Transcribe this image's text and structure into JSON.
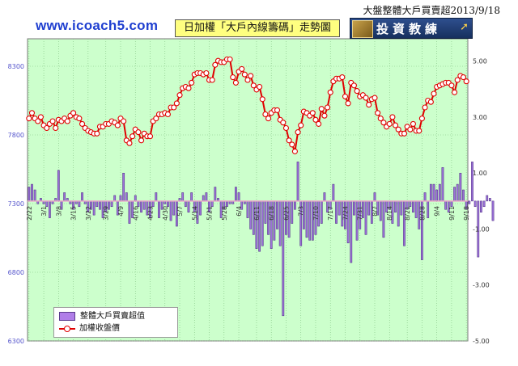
{
  "header": {
    "date_label": "大盤整體大戶買賣超2013/9/18",
    "site_url": "www.icoach5.com",
    "chart_title": "日加權「大戶內線籌碼」走勢圖",
    "logo_text": "投資教練"
  },
  "colors": {
    "plot_background": "#ccffcc",
    "grid": "#7fbf7f",
    "index_line": "#e00000",
    "index_marker_fill": "#ffffff",
    "bar_fill": "#9c72d8",
    "bar_stroke": "#4b2c80",
    "zero_line": "#e8a8c8",
    "left_axis_text": "#5555cc",
    "right_axis_text": "#333333"
  },
  "chart_data": {
    "type": "bar+line",
    "legend": {
      "position": "bottom-left",
      "entries": [
        "整體大戶買賣超值",
        "加權收盤價"
      ]
    },
    "left_axis": {
      "ticks": [
        "6300",
        "6800",
        "7300",
        "7800",
        "8300"
      ],
      "ylim": [
        6300,
        8500
      ]
    },
    "right_axis": {
      "ticks": [
        "-5.00",
        "-3.00",
        "-1.00",
        "1.00",
        "3.00",
        "5.00"
      ],
      "ylim": [
        -5,
        5.8
      ]
    },
    "x_ticks": [
      "2/22",
      "3/1",
      "3/8",
      "3/15",
      "3/22",
      "3/29",
      "4/9",
      "4/16",
      "4/23",
      "4/30",
      "5/7",
      "5/14",
      "5/21",
      "5/28",
      "6/4",
      "6/11",
      "6/18",
      "6/25",
      "7/3",
      "7/10",
      "7/17",
      "7/24",
      "7/31",
      "8/7",
      "8/14",
      "8/21",
      "8/28",
      "9/4",
      "9/11",
      "9/18"
    ],
    "series": [
      {
        "name": "加權收盤價",
        "kind": "line",
        "axis": "left",
        "values": [
          7920,
          7960,
          7920,
          7900,
          7930,
          7870,
          7850,
          7880,
          7900,
          7850,
          7910,
          7900,
          7920,
          7900,
          7940,
          7960,
          7930,
          7920,
          7880,
          7850,
          7830,
          7820,
          7810,
          7810,
          7860,
          7860,
          7880,
          7880,
          7900,
          7890,
          7870,
          7920,
          7900,
          7760,
          7740,
          7790,
          7840,
          7820,
          7760,
          7810,
          7790,
          7790,
          7900,
          7920,
          7950,
          7950,
          7960,
          7950,
          8000,
          8000,
          8030,
          8090,
          8140,
          8150,
          8140,
          8180,
          8240,
          8250,
          8250,
          8240,
          8250,
          8200,
          8200,
          8310,
          8340,
          8330,
          8330,
          8350,
          8350,
          8220,
          8180,
          8260,
          8280,
          8240,
          8200,
          8230,
          8160,
          8130,
          8150,
          8060,
          7950,
          7920,
          7960,
          7980,
          7980,
          7910,
          7890,
          7850,
          7760,
          7730,
          7680,
          7820,
          7870,
          7970,
          7960,
          7940,
          7960,
          7910,
          7880,
          7990,
          7940,
          8000,
          8110,
          8190,
          8210,
          8210,
          8220,
          8080,
          8030,
          8180,
          8160,
          8120,
          8080,
          8090,
          8070,
          8020,
          8060,
          8070,
          7960,
          7920,
          7890,
          7860,
          7880,
          7930,
          7870,
          7840,
          7810,
          7810,
          7860,
          7840,
          7880,
          7830,
          7830,
          7920,
          8000,
          8050,
          8040,
          8100,
          8150,
          8160,
          8170,
          8180,
          8180,
          8160,
          8110,
          8200,
          8230,
          8220,
          8190
        ]
      },
      {
        "name": "整體大戶買賣超值",
        "kind": "bar",
        "axis": "right",
        "values": [
          0.5,
          0.6,
          0.4,
          -0.1,
          0.1,
          -0.1,
          -0.2,
          -0.6,
          -0.1,
          0.1,
          1.1,
          -0.3,
          0.3,
          0.1,
          -0.1,
          -0.3,
          -0.1,
          -0.2,
          0.3,
          -0.1,
          -0.4,
          -0.3,
          -0.5,
          -0.2,
          -0.3,
          -0.6,
          -0.4,
          -0.3,
          -0.2,
          0.2,
          -0.5,
          0.2,
          1.0,
          0.3,
          -0.8,
          -0.6,
          0.2,
          -0.2,
          -0.4,
          -0.3,
          -0.5,
          -0.6,
          -0.2,
          0.3,
          -0.6,
          -0.3,
          -0.1,
          -0.2,
          -0.7,
          -0.5,
          -0.9,
          0.1,
          0.3,
          -0.2,
          -0.4,
          0.3,
          -0.4,
          -0.8,
          -0.5,
          0.2,
          0.3,
          -0.4,
          -0.2,
          0.5,
          0.1,
          -0.6,
          -0.3,
          -0.2,
          -0.1,
          -0.1,
          0.5,
          0.3,
          -0.3,
          -0.1,
          -0.6,
          -1.0,
          -1.2,
          -1.7,
          -1.8,
          -1.6,
          -0.8,
          -1.2,
          -1.7,
          -1.4,
          -1.0,
          -1.6,
          -4.1,
          -1.2,
          -1.3,
          -0.8,
          -0.3,
          1.4,
          -1.6,
          -1.0,
          -1.3,
          -1.4,
          -1.4,
          -1.2,
          -0.9,
          -0.8,
          0.3,
          -0.4,
          -0.3,
          0.6,
          -0.8,
          -0.5,
          -0.9,
          -1.0,
          -1.5,
          -2.2,
          -0.5,
          -1.4,
          -1.0,
          -0.6,
          -1.2,
          -0.5,
          -0.8,
          0.3,
          -0.5,
          -0.7,
          -1.3,
          -0.4,
          -0.3,
          -0.8,
          -0.4,
          -0.9,
          -0.5,
          -1.6,
          -0.3,
          -0.2,
          -0.4,
          -0.6,
          -1.0,
          -2.1,
          0.3,
          -0.6,
          0.6,
          0.6,
          0.4,
          0.6,
          1.2,
          -0.3,
          -0.4,
          -0.2,
          0.5,
          0.6,
          1.0,
          0.4,
          -0.3,
          -0.1,
          1.4,
          -0.2,
          -2.0,
          -0.4,
          -0.2,
          0.2,
          0.1,
          -0.7
        ]
      }
    ]
  }
}
